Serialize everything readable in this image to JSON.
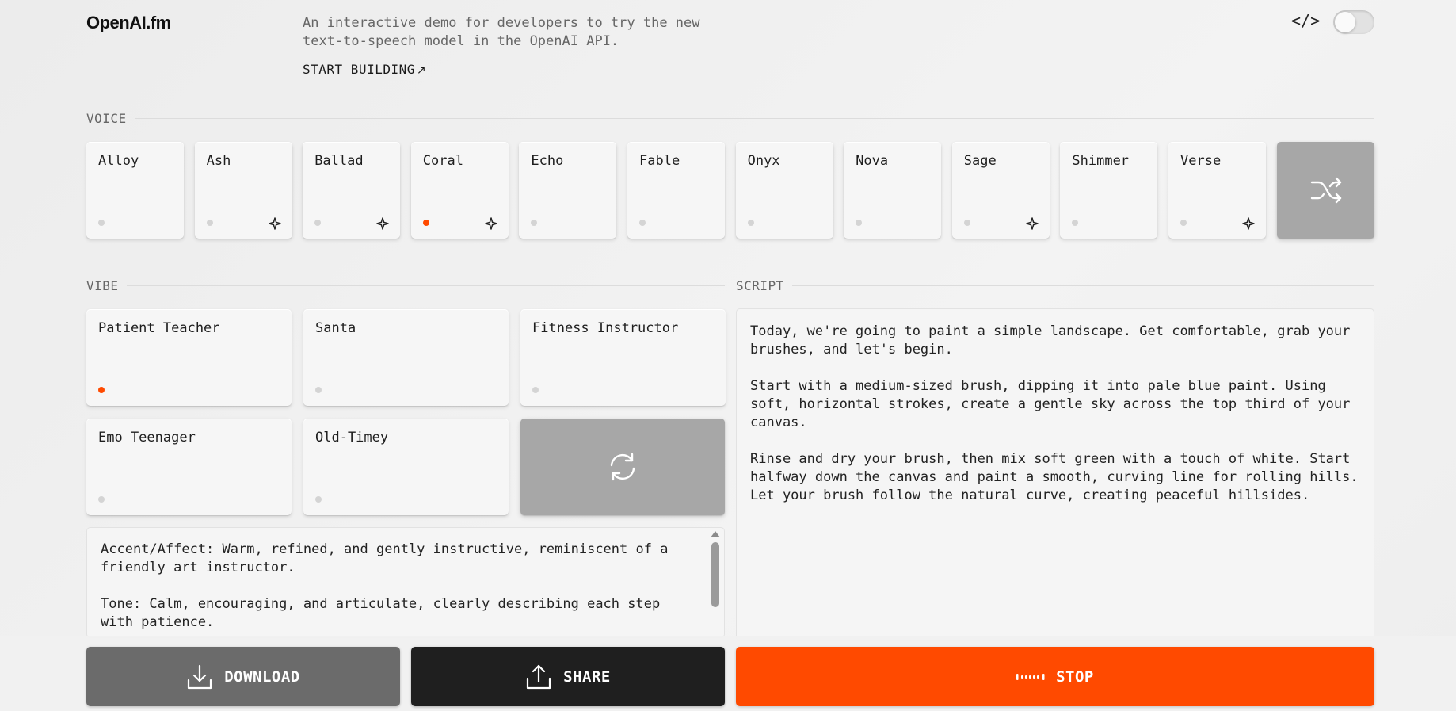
{
  "header": {
    "logo": "OpenAI.fm",
    "tagline": "An interactive demo for developers to try the new text-to-speech model in the OpenAI API.",
    "start_building": "START BUILDING",
    "code_toggle": "</>"
  },
  "voice": {
    "label": "VOICE",
    "items": [
      {
        "name": "Alloy",
        "active": false,
        "sparkle": false
      },
      {
        "name": "Ash",
        "active": false,
        "sparkle": true
      },
      {
        "name": "Ballad",
        "active": false,
        "sparkle": true
      },
      {
        "name": "Coral",
        "active": true,
        "sparkle": true
      },
      {
        "name": "Echo",
        "active": false,
        "sparkle": false
      },
      {
        "name": "Fable",
        "active": false,
        "sparkle": false
      },
      {
        "name": "Onyx",
        "active": false,
        "sparkle": false
      },
      {
        "name": "Nova",
        "active": false,
        "sparkle": false
      },
      {
        "name": "Sage",
        "active": false,
        "sparkle": true
      },
      {
        "name": "Shimmer",
        "active": false,
        "sparkle": false
      },
      {
        "name": "Verse",
        "active": false,
        "sparkle": true
      }
    ],
    "shuffle_icon": "shuffle-icon"
  },
  "vibe": {
    "label": "VIBE",
    "items": [
      {
        "name": "Patient Teacher",
        "active": true
      },
      {
        "name": "Santa",
        "active": false
      },
      {
        "name": "Fitness Instructor",
        "active": false
      },
      {
        "name": "Emo Teenager",
        "active": false
      },
      {
        "name": "Old-Timey",
        "active": false
      }
    ],
    "refresh_icon": "refresh-icon",
    "description": [
      "Accent/Affect: Warm, refined, and gently instructive, reminiscent of a friendly art instructor.",
      "Tone: Calm, encouraging, and articulate, clearly describing each step with patience."
    ]
  },
  "script": {
    "label": "SCRIPT",
    "paragraphs": [
      "Today, we're going to paint a simple landscape. Get comfortable, grab your brushes, and let's begin.",
      "Start with a medium-sized brush, dipping it into pale blue paint. Using soft, horizontal strokes, create a gentle sky across the top third of your canvas.",
      "Rinse and dry your brush, then mix soft green with a touch of white. Start halfway down the canvas and paint a smooth, curving line for rolling hills. Let your brush follow the natural curve, creating peaceful hillsides."
    ]
  },
  "actions": {
    "download": "DOWNLOAD",
    "share": "SHARE",
    "stop": "STOP"
  },
  "colors": {
    "accent": "#ff4a00",
    "download_bg": "#6b6b6b",
    "share_bg": "#1f1f1f"
  }
}
